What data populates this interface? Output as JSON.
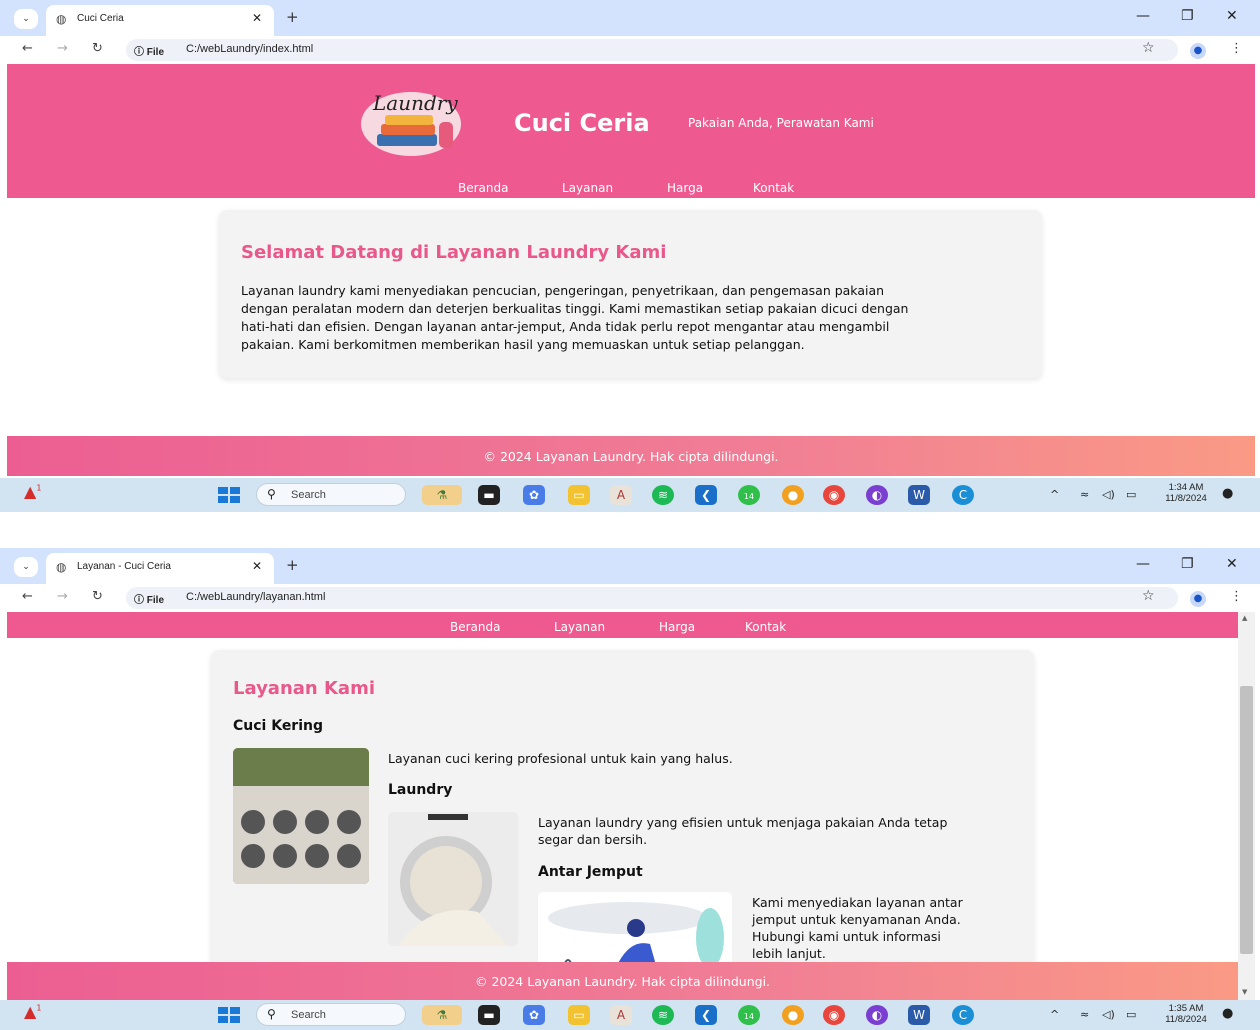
{
  "screens": [
    {
      "tab": {
        "title": "Cuci Ceria"
      },
      "address": {
        "chip": "File",
        "url": "C:/webLaundry/index.html"
      },
      "header": {
        "brand": "Cuci Ceria",
        "tagline": "Pakaian Anda, Perawatan Kami",
        "logo_text": "Laundry"
      },
      "nav": [
        "Beranda",
        "Layanan",
        "Harga",
        "Kontak"
      ],
      "welcome": {
        "title": "Selamat Datang di Layanan Laundry Kami",
        "lines": [
          "Layanan laundry kami menyediakan pencucian, pengeringan, penyetrikaan, dan pengemasan pakaian",
          "dengan peralatan modern dan deterjen berkualitas tinggi. Kami memastikan setiap pakaian dicuci dengan",
          "hati-hati dan efisien. Dengan layanan antar-jemput, Anda tidak perlu repot mengantar atau mengambil",
          "pakaian. Kami berkomitmen memberikan hasil yang memuaskan untuk setiap pelanggan."
        ]
      },
      "footer": "© 2024 Layanan Laundry. Hak cipta dilindungi.",
      "taskbar": {
        "search": "Search",
        "time": "1:34 AM",
        "date": "11/8/2024",
        "chrome_badge": "14",
        "notif_badge": "1"
      }
    },
    {
      "tab": {
        "title": "Layanan - Cuci Ceria"
      },
      "address": {
        "chip": "File",
        "url": "C:/webLaundry/layanan.html"
      },
      "nav": [
        "Beranda",
        "Layanan",
        "Harga",
        "Kontak"
      ],
      "services": {
        "title": "Layanan Kami",
        "items": [
          {
            "name": "Cuci Kering",
            "lines": [
              "Layanan cuci kering profesional untuk kain yang halus."
            ]
          },
          {
            "name": "Laundry",
            "lines": [
              "Layanan laundry yang efisien untuk menjaga pakaian Anda tetap",
              "segar dan bersih."
            ]
          },
          {
            "name": "Antar Jemput",
            "lines": [
              "Kami menyediakan layanan antar",
              "jemput untuk kenyamanan Anda.",
              "Hubungi kami untuk informasi",
              "lebih lanjut."
            ]
          }
        ]
      },
      "footer": "© 2024 Layanan Laundry. Hak cipta dilindungi.",
      "taskbar": {
        "search": "Search",
        "time": "1:35 AM",
        "date": "11/8/2024",
        "chrome_badge": "14",
        "notif_badge": "1"
      }
    }
  ],
  "colors": {
    "brand_pink": "#ee5a8f",
    "title_pink": "#e8588a",
    "tabstrip": "#d3e3fd",
    "taskbar": "#d2e4f2"
  }
}
